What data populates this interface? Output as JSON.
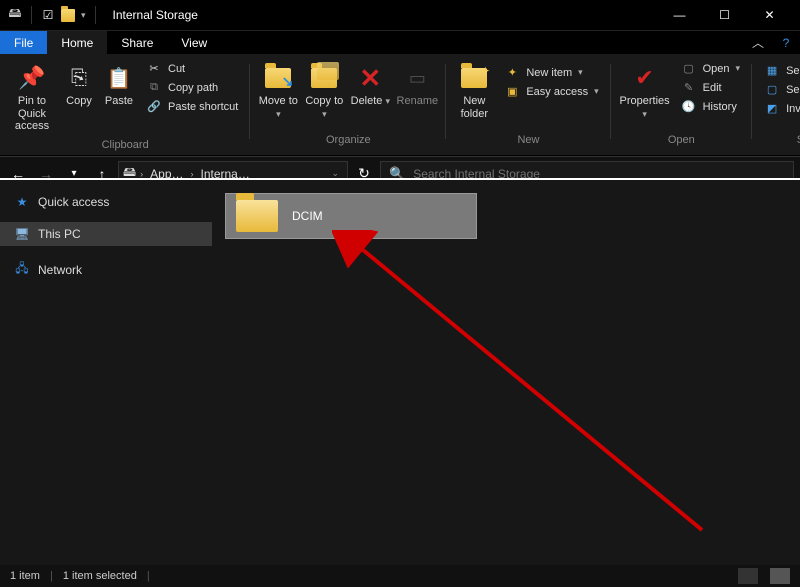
{
  "window": {
    "title": "Internal Storage"
  },
  "tabs": {
    "file": "File",
    "home": "Home",
    "share": "Share",
    "view": "View"
  },
  "ribbon": {
    "clipboard": {
      "label": "Clipboard",
      "pin": "Pin to Quick access",
      "copy": "Copy",
      "paste": "Paste",
      "cut": "Cut",
      "copy_path": "Copy path",
      "paste_shortcut": "Paste shortcut"
    },
    "organize": {
      "label": "Organize",
      "move_to": "Move to",
      "copy_to": "Copy to",
      "delete": "Delete",
      "rename": "Rename"
    },
    "new": {
      "label": "New",
      "new_folder": "New folder",
      "new_item": "New item",
      "easy_access": "Easy access"
    },
    "open": {
      "label": "Open",
      "properties": "Properties",
      "open": "Open",
      "edit": "Edit",
      "history": "History"
    },
    "select": {
      "label": "Select",
      "select_all": "Select all",
      "select_none": "Select none",
      "invert": "Invert selection"
    }
  },
  "addressbar": {
    "seg1": "App…",
    "seg2": "Interna…"
  },
  "search": {
    "placeholder": "Search Internal Storage"
  },
  "sidebar": {
    "items": [
      {
        "label": "Quick access"
      },
      {
        "label": "This PC"
      },
      {
        "label": "Network"
      }
    ]
  },
  "content": {
    "items": [
      {
        "name": "DCIM"
      }
    ]
  },
  "status": {
    "count": "1 item",
    "selected": "1 item selected"
  }
}
